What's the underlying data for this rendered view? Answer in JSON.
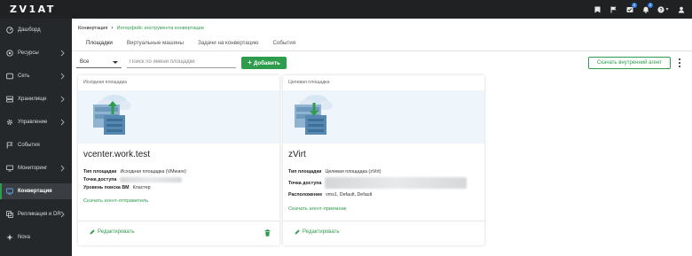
{
  "app": {
    "logo": "ZV1AT"
  },
  "topbar": {
    "icons": [
      "bookmark-icon",
      "flag-icon",
      "tasks-icon",
      "bell-icon",
      "help-icon",
      "user-icon"
    ],
    "tasks_badge": "2",
    "bell_badge": "2"
  },
  "sidebar": {
    "items": [
      {
        "label": "Дашборд",
        "icon": "dashboard-icon"
      },
      {
        "label": "Ресурсы",
        "icon": "resources-icon",
        "chevron": true
      },
      {
        "label": "Сеть",
        "icon": "network-icon",
        "chevron": true
      },
      {
        "label": "Хранилище",
        "icon": "storage-icon",
        "chevron": true
      },
      {
        "label": "Управление",
        "icon": "management-icon",
        "chevron": true
      },
      {
        "label": "События",
        "icon": "events-icon"
      },
      {
        "label": "Мониторинг",
        "icon": "monitoring-icon",
        "chevron": true
      },
      {
        "label": "Конвертация",
        "icon": "conversion-icon",
        "active": true
      },
      {
        "label": "Репликация и DR",
        "icon": "replication-icon",
        "chevron": true
      },
      {
        "label": "Nova",
        "icon": "nova-icon"
      }
    ]
  },
  "breadcrumb": {
    "root": "Конвертация",
    "current": "Интерфейс инструмента конвертации"
  },
  "tabs": [
    "Площадки",
    "Виртуальные машины",
    "Задачи на конвертацию",
    "События"
  ],
  "toolbar": {
    "filter_value": "Все",
    "search_placeholder": "Поиск по имени площадки",
    "add_label": "Добавить",
    "download_label": "Скачать внутренний агент"
  },
  "cards": [
    {
      "label": "Исходная площадка",
      "title": "vcenter.work.test",
      "props": [
        {
          "key": "Тип площадки",
          "value": "Исходная площадка (VMware)"
        },
        {
          "key": "Точка доступа",
          "value": ""
        },
        {
          "key": "Уровень поиска ВМ",
          "value": "Кластер"
        }
      ],
      "agent_link": "Скачать агент-отправитель",
      "edit_label": "Редактировать"
    },
    {
      "label": "Целевая площадка",
      "title": "zVirt",
      "props": [
        {
          "key": "Тип площадки",
          "value": "Целевая площадка (zVirt)"
        },
        {
          "key": "Точка доступа",
          "value": ""
        },
        {
          "key": "Расположение",
          "value": "vms1, Default, Default"
        }
      ],
      "agent_link": "Скачать агент-приемник",
      "edit_label": "Редактировать"
    }
  ],
  "colors": {
    "accent": "#2e9c4d",
    "topbar": "#1f2123",
    "sidebar": "#25282b"
  }
}
